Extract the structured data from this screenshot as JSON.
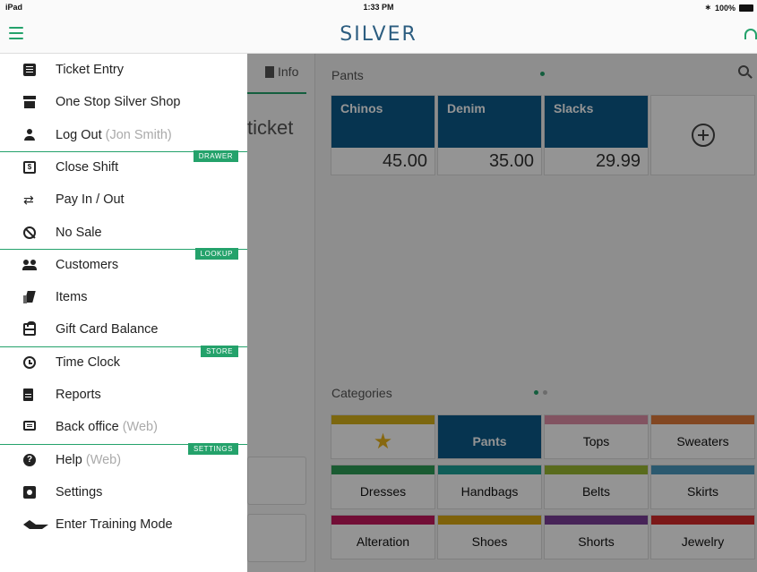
{
  "status_bar": {
    "device": "iPad",
    "time": "1:33 PM",
    "battery": "100%"
  },
  "header": {
    "logo": "SILVER"
  },
  "info_panel": {
    "info_label": "Info",
    "ticket_partial": "ticket"
  },
  "items_section": {
    "title": "Pants",
    "items": [
      {
        "name": "Chinos",
        "price": "45.00"
      },
      {
        "name": "Denim",
        "price": "35.00"
      },
      {
        "name": "Slacks",
        "price": "29.99"
      }
    ]
  },
  "categories_section": {
    "title": "Categories",
    "items": [
      {
        "name": "",
        "color": "#d6b11a",
        "icon": "star-icon"
      },
      {
        "name": "Pants",
        "color": "#0c5b8a",
        "selected": true
      },
      {
        "name": "Tops",
        "color": "#e08fa8"
      },
      {
        "name": "Sweaters",
        "color": "#e07a3c"
      },
      {
        "name": "Dresses",
        "color": "#2e9d57"
      },
      {
        "name": "Handbags",
        "color": "#1aa198"
      },
      {
        "name": "Belts",
        "color": "#9ab932"
      },
      {
        "name": "Skirts",
        "color": "#4b9ac0"
      },
      {
        "name": "Alteration",
        "color": "#c4195e"
      },
      {
        "name": "Shoes",
        "color": "#d9a914"
      },
      {
        "name": "Shorts",
        "color": "#7a3f98"
      },
      {
        "name": "Jewelry",
        "color": "#d42a2a"
      }
    ]
  },
  "drawer": {
    "items": [
      {
        "label": "Ticket Entry",
        "sub": "",
        "icon": "ticket-entry-icon"
      },
      {
        "label": "One Stop Silver Shop",
        "sub": "",
        "icon": "store-icon"
      },
      {
        "label": "Log Out",
        "sub": "(Jon Smith)",
        "icon": "person-icon"
      },
      {
        "label": "Close Shift",
        "sub": "",
        "icon": "cash-icon"
      },
      {
        "label": "Pay In / Out",
        "sub": "",
        "icon": "arrows-icon"
      },
      {
        "label": "No Sale",
        "sub": "",
        "icon": "no-sale-icon"
      },
      {
        "label": "Customers",
        "sub": "",
        "icon": "people-icon"
      },
      {
        "label": "Items",
        "sub": "",
        "icon": "tags-icon"
      },
      {
        "label": "Gift Card Balance",
        "sub": "",
        "icon": "gift-icon"
      },
      {
        "label": "Time Clock",
        "sub": "",
        "icon": "clock-icon"
      },
      {
        "label": "Reports",
        "sub": "",
        "icon": "report-icon"
      },
      {
        "label": "Back office",
        "sub": "(Web)",
        "icon": "monitor-icon"
      },
      {
        "label": "Help",
        "sub": "(Web)",
        "icon": "help-icon"
      },
      {
        "label": "Settings",
        "sub": "",
        "icon": "gear-icon"
      },
      {
        "label": "Enter Training Mode",
        "sub": "",
        "icon": "graduation-cap-icon"
      }
    ],
    "sections": {
      "drawer": "DRAWER",
      "lookup": "LOOKUP",
      "store": "STORE",
      "settings": "SETTINGS"
    }
  },
  "colors": {
    "accent": "#24a26b",
    "brand": "#2c5d80",
    "tile_blue": "#0c5b8a"
  }
}
